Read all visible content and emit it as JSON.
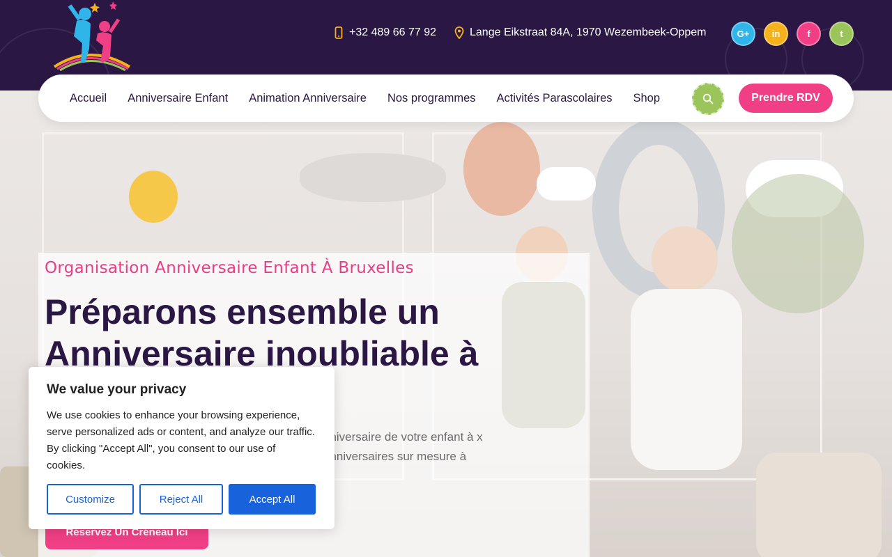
{
  "header": {
    "phone": "+32 489 66 77 92",
    "address": "Lange Eikstraat 84A, 1970 Wezembeek-Oppem",
    "phone_icon": "mobile-phone-icon",
    "address_icon": "map-pin-icon",
    "socials": [
      {
        "name": "google-plus",
        "label": "G+",
        "color": "#2fb5ea"
      },
      {
        "name": "linkedin",
        "label": "in",
        "color": "#f6b21b"
      },
      {
        "name": "facebook",
        "label": "f",
        "color": "#f03f85"
      },
      {
        "name": "twitter",
        "label": "t",
        "color": "#9bc45a"
      }
    ]
  },
  "nav": {
    "items": [
      "Accueil",
      "Anniversaire Enfant",
      "Animation Anniversaire",
      "Nos programmes",
      "Activités Parascolaires",
      "Shop"
    ],
    "search_icon": "search-icon",
    "rdv_label": "Prendre RDV"
  },
  "hero": {
    "kicker": "Organisation Anniversaire Enfant À Bruxelles",
    "headline": "Préparons ensemble un Anniversaire inoubliable à votre Enfant",
    "lead": "nniversaire de votre enfant à x anniversaires sur mesure à",
    "cta": "Réservez Un Créneau Ici"
  },
  "cookie": {
    "title": "We value your privacy",
    "body": "We use cookies to enhance your browsing experience, serve personalized ads or content, and analyze our traffic. By clicking \"Accept All\", you consent to our use of cookies.",
    "customize": "Customize",
    "reject": "Reject All",
    "accept": "Accept All"
  },
  "colors": {
    "brand_dark": "#2b1744",
    "brand_pink": "#f03f85",
    "brand_green": "#9bc45a",
    "cookie_blue": "#1863dc"
  }
}
